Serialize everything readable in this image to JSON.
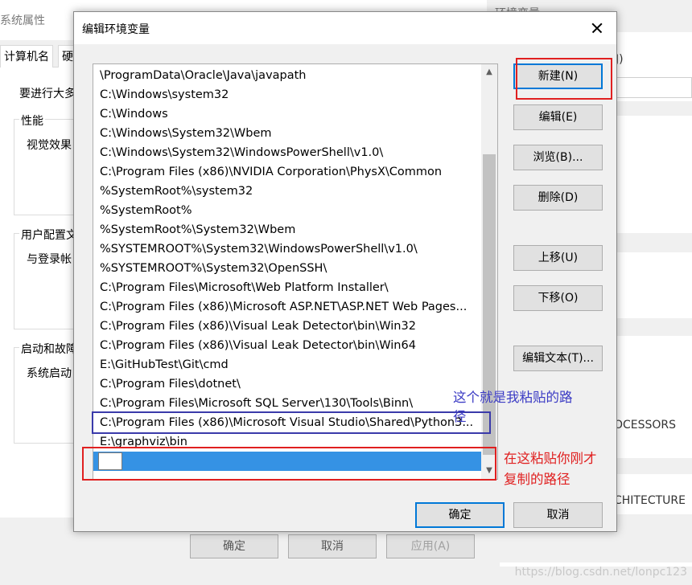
{
  "background_window": {
    "title": "系统属性",
    "tabs": [
      "计算机名",
      "硬"
    ],
    "intro": "要进行大多",
    "groups": [
      {
        "title": "性能",
        "text": "视觉效果"
      },
      {
        "title": "用户配置文",
        "text": "与登录帐"
      },
      {
        "title": "启动和故障",
        "text": "系统启动"
      }
    ],
    "buttons": [
      "确定",
      "取消",
      "应用(A)"
    ]
  },
  "right_window": {
    "title": "环境变量",
    "label_u": "J)",
    "processors": "OCESSORS",
    "architecture": "CHITECTURE"
  },
  "dialog": {
    "title": "编辑环境变量",
    "paths": [
      "\\ProgramData\\Oracle\\Java\\javapath",
      "C:\\Windows\\system32",
      "C:\\Windows",
      "C:\\Windows\\System32\\Wbem",
      "C:\\Windows\\System32\\WindowsPowerShell\\v1.0\\",
      "C:\\Program Files (x86)\\NVIDIA Corporation\\PhysX\\Common",
      "%SystemRoot%\\system32",
      "%SystemRoot%",
      "%SystemRoot%\\System32\\Wbem",
      "%SYSTEMROOT%\\System32\\WindowsPowerShell\\v1.0\\",
      "%SYSTEMROOT%\\System32\\OpenSSH\\",
      "C:\\Program Files\\Microsoft\\Web Platform Installer\\",
      "C:\\Program Files (x86)\\Microsoft ASP.NET\\ASP.NET Web Pages...",
      "C:\\Program Files (x86)\\Visual Leak Detector\\bin\\Win32",
      "C:\\Program Files (x86)\\Visual Leak Detector\\bin\\Win64",
      "E:\\GitHubTest\\Git\\cmd",
      "C:\\Program Files\\dotnet\\",
      "C:\\Program Files\\Microsoft SQL Server\\130\\Tools\\Binn\\",
      "C:\\Program Files (x86)\\Microsoft Visual Studio\\Shared\\Python3...",
      "E:\\graphviz\\bin"
    ],
    "buttons": {
      "new": "新建(N)",
      "edit": "编辑(E)",
      "browse": "浏览(B)...",
      "delete": "删除(D)",
      "move_up": "上移(U)",
      "move_down": "下移(O)",
      "edit_text": "编辑文本(T)...",
      "ok": "确定",
      "cancel": "取消"
    }
  },
  "annotations": {
    "blue_note_line1": "这个就是我粘贴的路",
    "blue_note_line2": "径",
    "red_note_line1": "在这粘贴你刚才",
    "red_note_line2": "复制的路径",
    "color_red": "#e02020",
    "color_blue": "#3b3bc4"
  },
  "watermark": "https://blog.csdn.net/lonpc123"
}
